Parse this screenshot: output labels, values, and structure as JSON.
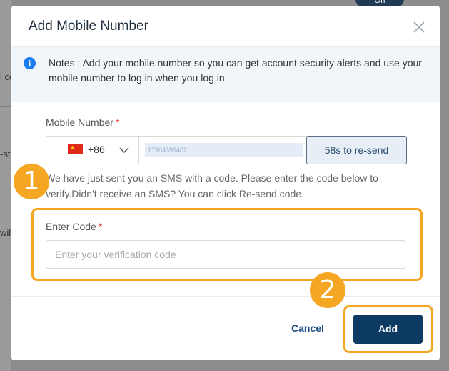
{
  "background": {
    "fragments": [
      "l co",
      "-st",
      "will"
    ],
    "toggle_label": "On"
  },
  "modal": {
    "title": "Add Mobile Number",
    "notice_text": "Notes : Add your mobile number so you can get account security alerts and use your mobile number to log in when you log in.",
    "mobile_label": "Mobile Number",
    "required_mark": "*",
    "country_code": "+86",
    "phone_number": "17304399402",
    "resend_label": "58s to re-send",
    "sms_note": "We have just sent you an SMS with a code. Please enter the code below to verify.Didn't receive an SMS? You can click Re-send code.",
    "code_label": "Enter Code",
    "code_placeholder": "Enter your verification code",
    "cancel_label": "Cancel",
    "add_label": "Add"
  },
  "annotations": {
    "step1": "1",
    "step2": "2",
    "highlight_color": "#f5a623"
  },
  "icons": {
    "close": "close-icon",
    "info": "info-icon",
    "flag": "china-flag-icon",
    "dropdown": "chevron-down-icon"
  },
  "colors": {
    "primary": "#0d3b63",
    "info": "#1c7df0",
    "required": "#e03c3c"
  }
}
